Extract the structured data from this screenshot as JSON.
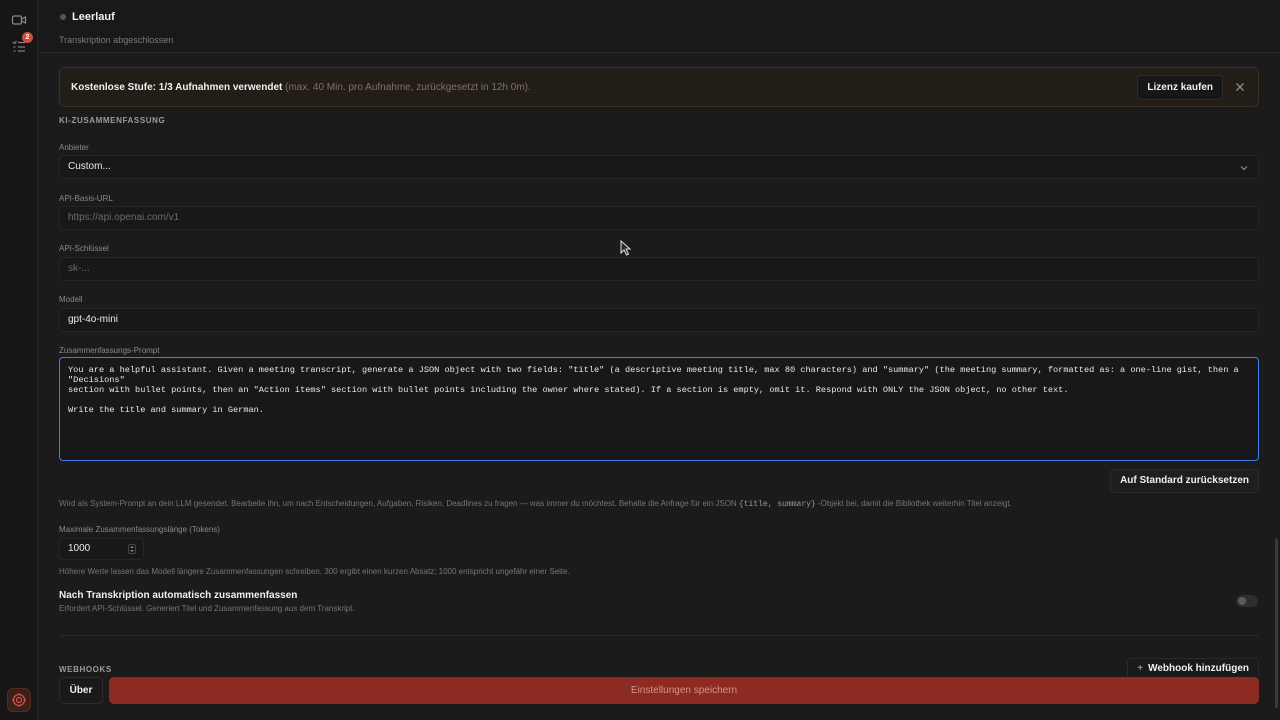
{
  "rail": {
    "badge_count": "2"
  },
  "header": {
    "status_title": "Leerlauf",
    "status_sub": "Transkription abgeschlossen"
  },
  "banner": {
    "bold": "Kostenlose Stufe: 1/3 Aufnahmen verwendet",
    "muted": " (max. 40 Min. pro Aufnahme, zurückgesetzt in 12h 0m).",
    "button": "Lizenz kaufen"
  },
  "ai_summary": {
    "section_title": "KI-ZUSAMMENFASSUNG",
    "provider_label": "Anbieter",
    "provider_value": "Custom...",
    "base_url_label": "API-Basis-URL",
    "base_url_placeholder": "https://api.openai.com/v1",
    "api_key_label": "API-Schlüssel",
    "api_key_placeholder": "sk-...",
    "model_label": "Modell",
    "model_value": "gpt-4o-mini",
    "prompt_label": "Zusammenfassungs-Prompt",
    "prompt_value": "You are a helpful assistant. Given a meeting transcript, generate a JSON object with two fields: \"title\" (a descriptive meeting title, max 80 characters) and \"summary\" (the meeting summary, formatted as: a one-line gist, then a \"Decisions\"\nsection with bullet points, then an \"Action items\" section with bullet points including the owner where stated). If a section is empty, omit it. Respond with ONLY the JSON object, no other text.\n\nWrite the title and summary in German.",
    "reset_button": "Auf Standard zurücksetzen",
    "prompt_help_a": "Wird als System-Prompt an dein LLM gesendet. Bearbeite ihn, um nach Entscheidungen, Aufgaben, Risiken, Deadlines zu fragen — was immer du möchtest. Behalte die Anfrage für ein JSON ",
    "prompt_help_code": "{title, summary}",
    "prompt_help_b": " -Objekt bei, damit die Bibliothek weiterhin Titel anzeigt.",
    "max_len_label": "Maximale Zusammenfassungslänge (Tokens)",
    "max_len_value": "1000",
    "max_len_help": "Höhere Werte lassen das Modell längere Zusammenfassungen schreiben. 300 ergibt einen kurzen Absatz; 1000 entspricht ungefähr einer Seite.",
    "auto_title": "Nach Transkription automatisch zusammenfassen",
    "auto_help": "Erfordert API-Schlüssel. Generiert Titel und Zusammenfassung aus dem Transkript.",
    "auto_enabled": false
  },
  "webhooks": {
    "section_title": "WEBHOOKS",
    "add_button": "Webhook hinzufügen"
  },
  "footer": {
    "about": "Über",
    "save": "Einstellungen speichern"
  },
  "colors": {
    "accent_focus": "#3f7de8",
    "save_button": "#8c2b23",
    "badge": "#d44a3c"
  }
}
